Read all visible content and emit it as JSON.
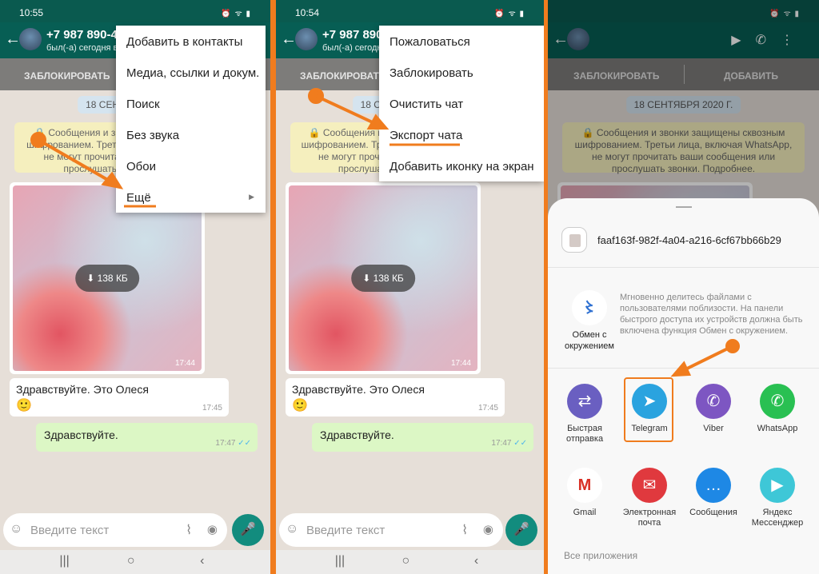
{
  "accent_color": "#f07c1e",
  "whatsapp_color": "#075e54",
  "chat": {
    "contact": "+7 987 890-4",
    "last_seen": "был(-а) сегодня в",
    "block_label": "ЗАБЛОКИРОВАТЬ",
    "add_label": "ДОБАВИТЬ",
    "date_chip": "18 СЕНТЯБРЯ 2020 Г.",
    "notice": "🔒 Сообщения и звонки защищены сквозным шифрованием. Третьи лица, включая WhatsApp, не могут прочитать ваши сообщения или прослушать звонки. Подробнее.",
    "image_size": "⬇ 138 КБ",
    "image_time": "17:44",
    "msg_in": "Здравствуйте. Это Олеся",
    "msg_in_emoji": "🙂",
    "msg_in_time": "17:45",
    "msg_out": "Здравствуйте.",
    "msg_out_time": "17:47",
    "msg_out_ticks": "✓✓",
    "input_placeholder": "Введите текст"
  },
  "panels": [
    {
      "time": "10:55",
      "menu": [
        {
          "label": "Добавить в контакты"
        },
        {
          "label": "Медиа, ссылки и докум."
        },
        {
          "label": "Поиск"
        },
        {
          "label": "Без звука"
        },
        {
          "label": "Обои"
        },
        {
          "label": "Ещё",
          "submenu": true,
          "highlighted": true
        }
      ]
    },
    {
      "time": "10:54",
      "menu": [
        {
          "label": "Пожаловаться"
        },
        {
          "label": "Заблокировать"
        },
        {
          "label": "Очистить чат"
        },
        {
          "label": "Экспорт чата",
          "highlighted": true
        },
        {
          "label": "Добавить иконку на экран"
        }
      ]
    },
    {
      "time": ""
    }
  ],
  "share": {
    "file_name": "faaf163f-982f-4a04-a216-6cf67bb66b29",
    "nearby_label": "Обмен с окружением",
    "nearby_text": "Мгновенно делитесь файлами с пользователями поблизости. На панели быстрого доступа их устройств должна быть включена функция Обмен с окружением.",
    "apps": [
      {
        "label": "Быстрая отправка",
        "icon": "quick-share-icon",
        "color": "#6a5fc1"
      },
      {
        "label": "Telegram",
        "icon": "telegram-icon",
        "color": "#2aa3df",
        "highlighted": true
      },
      {
        "label": "Viber",
        "icon": "viber-icon",
        "color": "#7d56c2"
      },
      {
        "label": "WhatsApp",
        "icon": "whatsapp-icon",
        "color": "#29c052"
      },
      {
        "label": "Gmail",
        "icon": "gmail-icon",
        "color": "#ffffff"
      },
      {
        "label": "Электронная почта",
        "icon": "email-icon",
        "color": "#e0393e"
      },
      {
        "label": "Сообщения",
        "icon": "messages-icon",
        "color": "#1e88e5"
      },
      {
        "label": "Яндекс Мессенджер",
        "icon": "yandex-messenger-icon",
        "color": "#3ec7d7"
      }
    ],
    "all_apps": "Все приложения"
  }
}
